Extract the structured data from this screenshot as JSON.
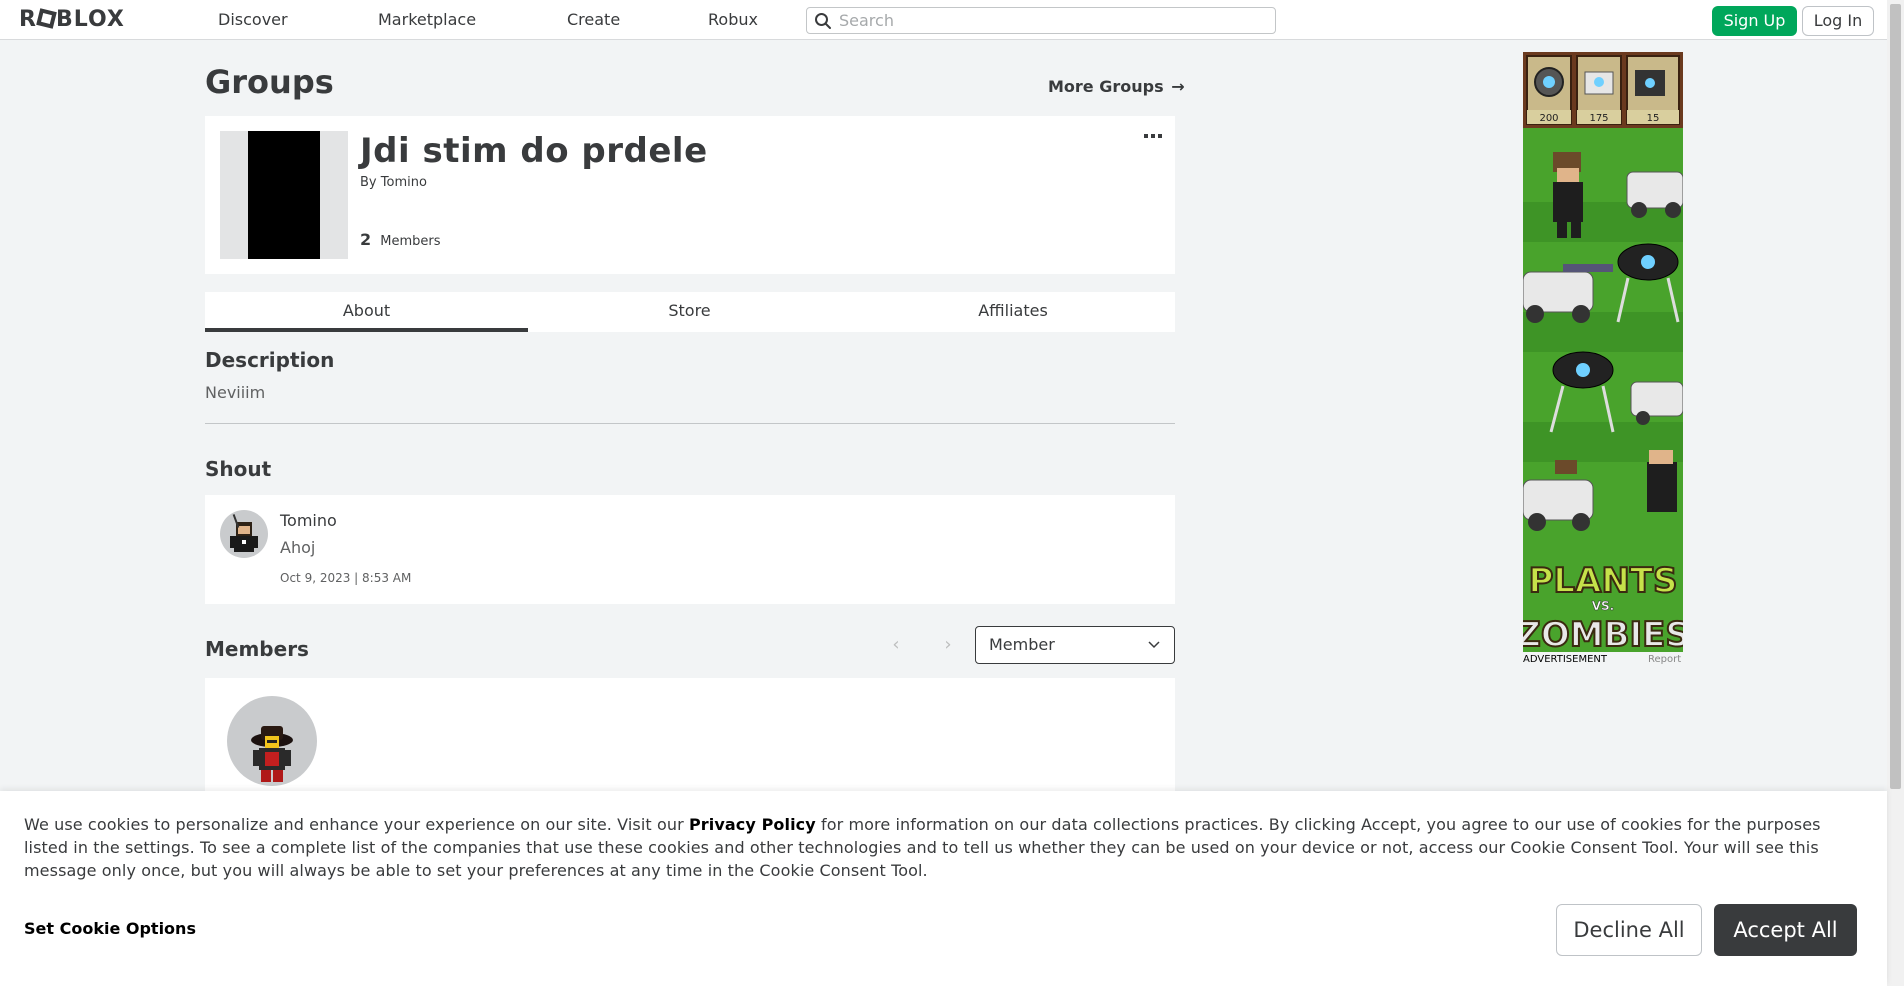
{
  "nav": {
    "logo": "ROBLOX",
    "links": [
      "Discover",
      "Marketplace",
      "Create",
      "Robux"
    ],
    "search_placeholder": "Search",
    "sign_up": "Sign Up",
    "log_in": "Log In"
  },
  "page": {
    "title": "Groups",
    "more_groups": "More Groups",
    "more_groups_arrow": "→"
  },
  "group": {
    "name": "Jdi stim do prdele",
    "by_label": "By",
    "owner": "Tomino",
    "member_count": "2",
    "members_label": "Members"
  },
  "tabs": [
    "About",
    "Store",
    "Affiliates"
  ],
  "active_tab": "About",
  "description": {
    "heading": "Description",
    "text": "Neviiim"
  },
  "shout": {
    "heading": "Shout",
    "poster": "Tomino",
    "body": "Ahoj",
    "date": "Oct 9, 2023 | 8:53 AM"
  },
  "members": {
    "heading": "Members",
    "role_selected": "Member",
    "prev_glyph": "‹",
    "next_glyph": "›"
  },
  "ad": {
    "label": "ADVERTISEMENT",
    "report": "Report",
    "costs": [
      "200",
      "175",
      "15"
    ],
    "title_top": "PLANTS",
    "title_vs": "VS.",
    "title_bottom": "ZOMBIES"
  },
  "cookie": {
    "text_before": "We use cookies to personalize and enhance your experience on our site. Visit our ",
    "privacy_link": "Privacy Policy",
    "text_after": " for more information on our data collections practices. By clicking Accept, you agree to our use of cookies for the purposes listed in the settings. To see a complete list of the companies that use these cookies and other technologies and to tell us whether they can be used on your device or not, access our Cookie Consent Tool. Your will see this message only once, but you will always be able to set your preferences at any time in the Cookie Consent Tool.",
    "options": "Set Cookie Options",
    "decline": "Decline All",
    "accept": "Accept All"
  },
  "colors": {
    "accent_green": "#00a75b",
    "text_dark": "#393b3d",
    "page_bg": "#f2f4f5"
  }
}
